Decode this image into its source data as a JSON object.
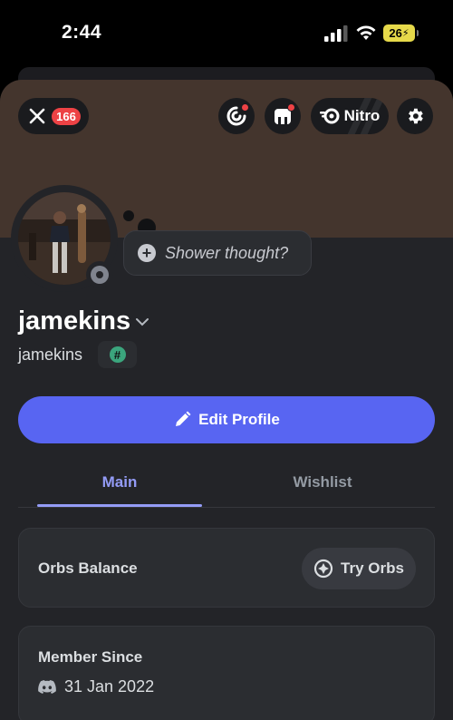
{
  "status_bar": {
    "time": "2:44",
    "battery": "26"
  },
  "header": {
    "notification_count": "166",
    "nitro_label": "Nitro"
  },
  "profile": {
    "thought_placeholder": "Shower thought?",
    "display_name": "jamekins",
    "username": "jamekins",
    "edit_button": "Edit Profile"
  },
  "tabs": [
    {
      "label": "Main",
      "active": true
    },
    {
      "label": "Wishlist",
      "active": false
    }
  ],
  "orbs": {
    "label": "Orbs Balance",
    "button": "Try Orbs"
  },
  "member": {
    "title": "Member Since",
    "date": "31 Jan 2022"
  },
  "colors": {
    "accent": "#5865f2",
    "banner": "#44352d",
    "tab_active": "#949cf7",
    "badge_red": "#ed4245"
  }
}
